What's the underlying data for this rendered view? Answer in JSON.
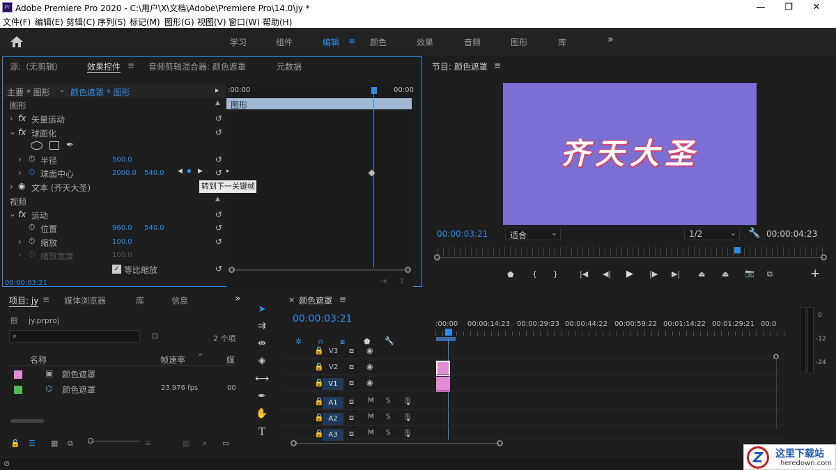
{
  "window": {
    "title": "Adobe Premiere Pro 2020 - C:\\用户\\X\\文档\\Adobe\\Premiere Pro\\14.0\\jy *",
    "app_icon": "Pr",
    "min": "—",
    "max": "❐",
    "close": "✕"
  },
  "menu": [
    "文件(F)",
    "编辑(E)",
    "剪辑(C)",
    "序列(S)",
    "标记(M)",
    "图形(G)",
    "视图(V)",
    "窗口(W)",
    "帮助(H)"
  ],
  "workspace": {
    "tabs": [
      "学习",
      "组件",
      "编辑",
      "颜色",
      "效果",
      "音频",
      "图形",
      "库"
    ],
    "active": "编辑",
    "more": "»",
    "menu_icon": "≡"
  },
  "effect_panel": {
    "tabs": [
      "源:（无剪辑）",
      "效果控件",
      "音频剪辑混合器: 颜色遮罩",
      "元数据"
    ],
    "tab_menu": "≡",
    "master": "主要 * 图形",
    "clip": "颜色遮罩 * 图形",
    "ruler_start": ":00:00",
    "ruler_end": "00:00",
    "clip_bar": "图形",
    "section_graphics": "图形",
    "vector_motion": "矢量运动",
    "spherize": "球面化",
    "radius_label": "半径",
    "radius_value": "500.0",
    "center_label": "球面中心",
    "center_x": "2000.0",
    "center_y": "540.0",
    "tooltip": "转到下一关键帧",
    "text_layer": "文本 (齐天大圣)",
    "section_video": "视频",
    "motion": "运动",
    "position_label": "位置",
    "position_x": "960.0",
    "position_y": "540.0",
    "scale_label": "缩放",
    "scale_value": "100.0",
    "scale_width_label": "缩放宽度",
    "scale_width_value": "100.0",
    "uniform_scale": "等比缩放",
    "fx": "fx",
    "timecode": "00:00:03:21"
  },
  "program": {
    "title": "节目: 颜色遮罩",
    "menu": "≡",
    "overlay_text": "齐天大圣",
    "bg_color": "#7b6fd6",
    "timecode_left": "00:00:03:21",
    "fit": "适合",
    "resolution": "1/2",
    "timecode_right": "00:00:04:23",
    "add": "+"
  },
  "project": {
    "tabs": [
      "项目: jy",
      "媒体浏览器",
      "库",
      "信息"
    ],
    "menu": "≡",
    "more": "»",
    "file": "jy.prproj",
    "count": "2 个项",
    "col_name": "名称",
    "col_fps": "帧速率",
    "col_media": "媒",
    "items": [
      {
        "name": "颜色遮罩",
        "fps": "",
        "media": "",
        "color": "#e48ad6"
      },
      {
        "name": "颜色遮罩",
        "fps": "23.976 fps",
        "media": "00",
        "color": "#52b84f"
      }
    ]
  },
  "timeline": {
    "title": "颜色遮罩",
    "close": "×",
    "menu": "≡",
    "timecode": "00:00:03:21",
    "ruler": [
      ":00:00",
      "00:00:14:23",
      "00:00:29:23",
      "00:00:44:22",
      "00:00:59:22",
      "00:01:14:22",
      "00:01:29:21",
      "00:0"
    ],
    "video_tracks": [
      "V3",
      "V2",
      "V1"
    ],
    "audio_tracks": [
      "A1",
      "A2",
      "A3"
    ],
    "track_m": "M",
    "track_s": "S",
    "meter_labels": [
      "0",
      "-12",
      "-24"
    ]
  },
  "watermark": {
    "name": "这里下载站",
    "url": "heredown.com"
  }
}
